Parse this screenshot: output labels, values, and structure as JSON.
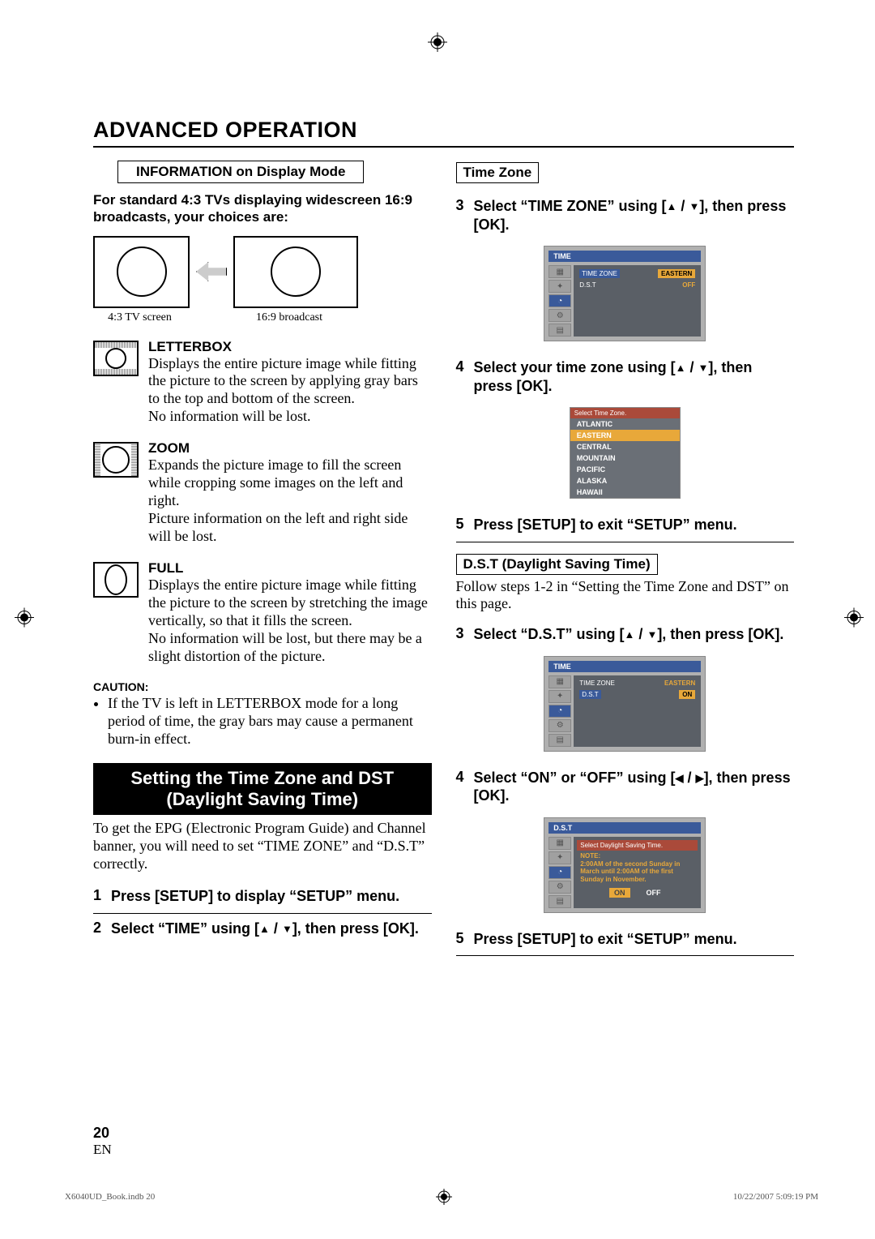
{
  "header": "ADVANCED OPERATION",
  "left": {
    "info_label": "INFORMATION on Display Mode",
    "intro": "For standard 4:3 TVs displaying widescreen 16:9 broadcasts, your choices are:",
    "cap43": "4:3 TV screen",
    "cap169": "16:9 broadcast",
    "modes": {
      "letterbox": {
        "title": "LETTERBOX",
        "body": "Displays the entire picture image while fitting the picture to the screen by applying gray bars to the top and bottom of the screen.\nNo information will be lost."
      },
      "zoom": {
        "title": "ZOOM",
        "body": "Expands the picture image to fill the screen while cropping some images on the left and right.\nPicture information on the left and right side will be lost."
      },
      "full": {
        "title": "FULL",
        "body": "Displays the entire picture image while fitting the picture to the screen by stretching the image vertically, so that it fills the screen.\nNo information will be lost, but there may be a slight distortion of the picture."
      }
    },
    "caution_label": "CAUTION:",
    "caution_item": "If the TV is left in LETTERBOX mode for a long period of time, the gray bars may cause a permanent burn-in effect.",
    "banner": "Setting the Time Zone and DST (Daylight Saving Time)",
    "banner_body": "To get the EPG (Electronic Program Guide) and Channel banner, you will need to set “TIME ZONE” and “D.S.T” correctly.",
    "step1": "Press [SETUP] to display “SETUP” menu.",
    "step2a": "Select “TIME” using [",
    "step2b": "], then press [OK]."
  },
  "right": {
    "tz_label": "Time Zone",
    "step3a": "Select “TIME ZONE” using [",
    "step3b": "], then press [OK].",
    "step4a": "Select your time zone using [",
    "step4b": "], then press [OK].",
    "step5": "Press [SETUP] to exit “SETUP” menu.",
    "dst_label": "D.S.T (Daylight Saving Time)",
    "dst_intro": "Follow steps 1-2 in “Setting the Time Zone and DST” on this page.",
    "dst_step3a": "Select “D.S.T” using [",
    "dst_step3b": "], then press [OK].",
    "dst_step4a": "Select “ON” or “OFF” using [",
    "dst_step4b": "], then press [OK].",
    "dst_step5": "Press [SETUP] to exit “SETUP” menu."
  },
  "osd": {
    "time_title": "TIME",
    "row_tz_label": "TIME ZONE",
    "row_tz_val": "EASTERN",
    "row_dst_label": "D.S.T",
    "row_dst_val_off": "OFF",
    "row_dst_val_on": "ON",
    "tz_select_hdr": "Select Time Zone.",
    "tz_items": [
      "ATLANTIC",
      "EASTERN",
      "CENTRAL",
      "MOUNTAIN",
      "PACIFIC",
      "ALASKA",
      "HAWAII"
    ],
    "dst_title": "D.S.T",
    "dst_hdr": "Select Daylight Saving Time.",
    "dst_note_label": "NOTE:",
    "dst_note_body": "2:00AM of the second Sunday in March until 2:00AM of the first Sunday in November.",
    "dst_on": "ON",
    "dst_off": "OFF"
  },
  "footer": {
    "page": "20",
    "lang": "EN",
    "file": "X6040UD_Book.indb   20",
    "timestamp": "10/22/2007   5:09:19 PM"
  }
}
